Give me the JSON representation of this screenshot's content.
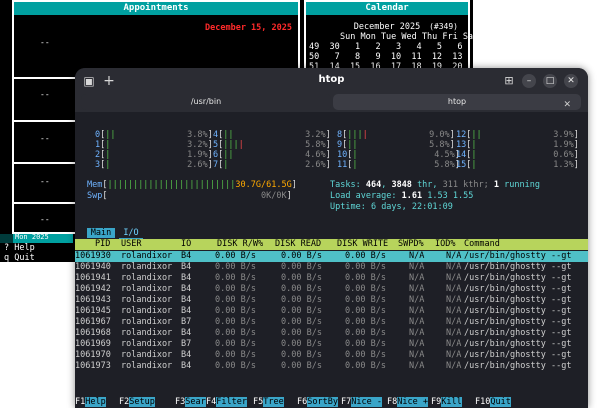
{
  "bg_app": {
    "appointments_title": "Appointments",
    "appointment_date": "December 15, 2025",
    "slot_marker": "--",
    "calendar_title": "Calendar",
    "calendar_month": "December 2025",
    "calendar_id": "(#349)",
    "calendar_dow": "Sun Mon Tue Wed Thu Fri Sat",
    "calendar_rows": [
      "49  30   1   2   3   4   5   6",
      "50   7   8   9  10  11  12  13",
      "51  14  15  16  17  18  19  20"
    ],
    "status_bar": "Mon 2025",
    "help_key": "?",
    "help_label": "Help",
    "quit_key": "q",
    "quit_label": "Quit"
  },
  "window": {
    "title": "htop",
    "tabs": [
      {
        "label": "/usr/bin"
      },
      {
        "label": "htop"
      }
    ],
    "new_tab": "+",
    "close_tab": "✕"
  },
  "htop": {
    "cpus": [
      {
        "id": "0",
        "pct": "3.8%"
      },
      {
        "id": "1",
        "pct": "3.2%"
      },
      {
        "id": "2",
        "pct": "1.9%"
      },
      {
        "id": "3",
        "pct": "2.6%"
      },
      {
        "id": "4",
        "pct": "3.2%"
      },
      {
        "id": "5",
        "pct": "5.8%"
      },
      {
        "id": "6",
        "pct": "4.6%"
      },
      {
        "id": "7",
        "pct": "2.6%"
      },
      {
        "id": "8",
        "pct": "9.0%"
      },
      {
        "id": "9",
        "pct": "5.8%"
      },
      {
        "id": "10",
        "pct": "4.5%"
      },
      {
        "id": "11",
        "pct": "5.8%"
      },
      {
        "id": "12",
        "pct": "3.9%"
      },
      {
        "id": "13",
        "pct": "1.9%"
      },
      {
        "id": "14",
        "pct": "0.6%"
      },
      {
        "id": "15",
        "pct": "1.3%"
      }
    ],
    "mem_label": "Mem",
    "mem_value": "30.7G/61.5G",
    "swp_label": "Swp",
    "swp_value": "0K/0K",
    "tasks_label": "Tasks:",
    "tasks_count": "464",
    "threads": "3848",
    "thr_label": "thr,",
    "kthr": "311 kthr;",
    "running": "1",
    "running_label": "running",
    "load_label": "Load average:",
    "load1": "1.61",
    "load5": "1.53",
    "load15": "1.55",
    "uptime_label": "Uptime:",
    "uptime": "6 days, 22:01:09",
    "tab_main": "Main",
    "tab_io": "I/O",
    "columns": [
      "PID",
      "USER",
      "IO",
      "DISK R/W%",
      "DISK READ",
      "DISK WRITE",
      "SWPD%",
      "IOD%",
      "Command"
    ],
    "rows": [
      {
        "pid": "1061930",
        "user": "rolandixor",
        "io": "B4",
        "rw": "0.00 B/s",
        "read": "0.00 B/s",
        "write": "0.00 B/s",
        "swpd": "N/A",
        "iod": "N/A",
        "cmd": "/usr/bin/ghostty --gt"
      },
      {
        "pid": "1061940",
        "user": "rolandixor",
        "io": "B4",
        "rw": "0.00 B/s",
        "read": "0.00 B/s",
        "write": "0.00 B/s",
        "swpd": "N/A",
        "iod": "N/A",
        "cmd": "/usr/bin/ghostty --gt"
      },
      {
        "pid": "1061941",
        "user": "rolandixor",
        "io": "B4",
        "rw": "0.00 B/s",
        "read": "0.00 B/s",
        "write": "0.00 B/s",
        "swpd": "N/A",
        "iod": "N/A",
        "cmd": "/usr/bin/ghostty --gt"
      },
      {
        "pid": "1061942",
        "user": "rolandixor",
        "io": "B4",
        "rw": "0.00 B/s",
        "read": "0.00 B/s",
        "write": "0.00 B/s",
        "swpd": "N/A",
        "iod": "N/A",
        "cmd": "/usr/bin/ghostty --gt"
      },
      {
        "pid": "1061943",
        "user": "rolandixor",
        "io": "B4",
        "rw": "0.00 B/s",
        "read": "0.00 B/s",
        "write": "0.00 B/s",
        "swpd": "N/A",
        "iod": "N/A",
        "cmd": "/usr/bin/ghostty --gt"
      },
      {
        "pid": "1061945",
        "user": "rolandixor",
        "io": "B4",
        "rw": "0.00 B/s",
        "read": "0.00 B/s",
        "write": "0.00 B/s",
        "swpd": "N/A",
        "iod": "N/A",
        "cmd": "/usr/bin/ghostty --gt"
      },
      {
        "pid": "1061967",
        "user": "rolandixor",
        "io": "B7",
        "rw": "0.00 B/s",
        "read": "0.00 B/s",
        "write": "0.00 B/s",
        "swpd": "N/A",
        "iod": "N/A",
        "cmd": "/usr/bin/ghostty --gt"
      },
      {
        "pid": "1061968",
        "user": "rolandixor",
        "io": "B4",
        "rw": "0.00 B/s",
        "read": "0.00 B/s",
        "write": "0.00 B/s",
        "swpd": "N/A",
        "iod": "N/A",
        "cmd": "/usr/bin/ghostty --gt"
      },
      {
        "pid": "1061969",
        "user": "rolandixor",
        "io": "B7",
        "rw": "0.00 B/s",
        "read": "0.00 B/s",
        "write": "0.00 B/s",
        "swpd": "N/A",
        "iod": "N/A",
        "cmd": "/usr/bin/ghostty --gt"
      },
      {
        "pid": "1061970",
        "user": "rolandixor",
        "io": "B4",
        "rw": "0.00 B/s",
        "read": "0.00 B/s",
        "write": "0.00 B/s",
        "swpd": "N/A",
        "iod": "N/A",
        "cmd": "/usr/bin/ghostty --gt"
      },
      {
        "pid": "1061973",
        "user": "rolandixor",
        "io": "B4",
        "rw": "0.00 B/s",
        "read": "0.00 B/s",
        "write": "0.00 B/s",
        "swpd": "N/A",
        "iod": "N/A",
        "cmd": "/usr/bin/ghostty --gt"
      }
    ],
    "fkeys": [
      {
        "key": "F1",
        "label": "Help"
      },
      {
        "key": "F2",
        "label": "Setup"
      },
      {
        "key": "F3",
        "label": "Search"
      },
      {
        "key": "F4",
        "label": "Filter"
      },
      {
        "key": "F5",
        "label": "Tree"
      },
      {
        "key": "F6",
        "label": "SortBy"
      },
      {
        "key": "F7",
        "label": "Nice -"
      },
      {
        "key": "F8",
        "label": "Nice +"
      },
      {
        "key": "F9",
        "label": "Kill"
      },
      {
        "key": "F10",
        "label": "Quit"
      }
    ]
  },
  "colors": {
    "header_bg": "#b7d45c",
    "selected_row": "#4fc0c7",
    "accent": "#3aa5c8",
    "calendar_header": "#00a0a0",
    "date_red": "#ff2a2a"
  }
}
